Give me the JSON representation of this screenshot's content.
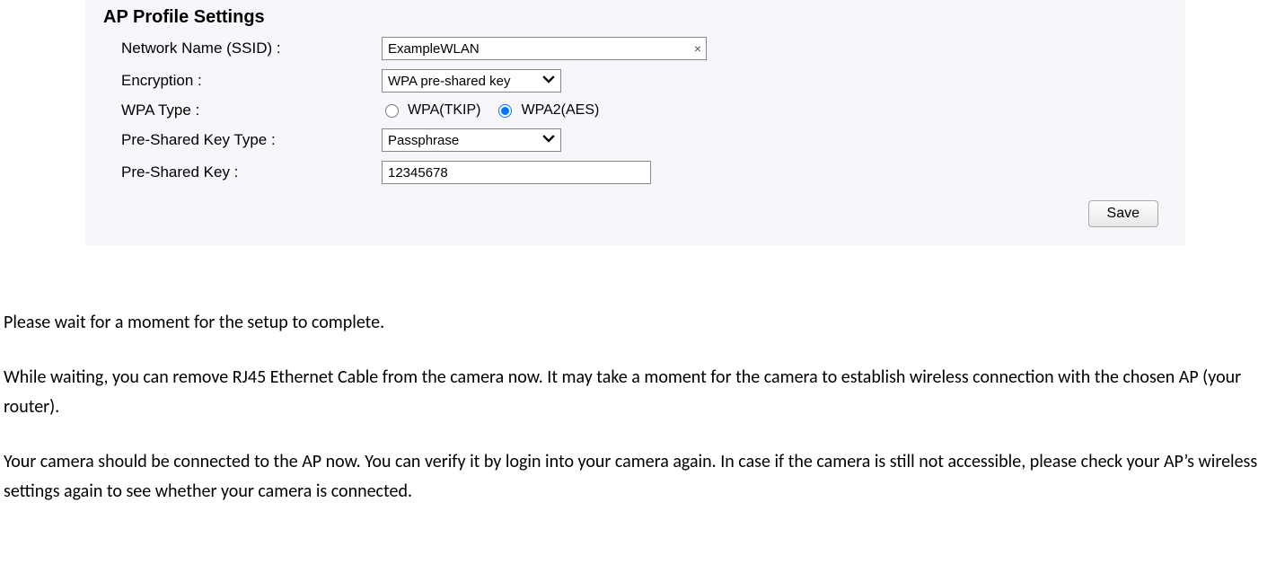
{
  "panel": {
    "title": "AP Profile Settings",
    "ssid_label": "Network Name (SSID) :",
    "ssid_value": "ExampleWLAN",
    "encryption_label": "Encryption :",
    "encryption_value": "WPA pre-shared key",
    "wpa_type_label": "WPA Type :",
    "wpa_tkip_label": "WPA(TKIP)",
    "wpa2_aes_label": "WPA2(AES)",
    "psk_type_label": "Pre-Shared Key Type :",
    "psk_type_value": "Passphrase",
    "psk_label": "Pre-Shared Key :",
    "psk_value": "12345678",
    "save_label": "Save"
  },
  "instructions": {
    "p1": "Please wait for a moment for the setup to complete.",
    "p2": "While waiting, you can remove RJ45 Ethernet Cable from the camera now. It may take a moment for the camera to establish wireless connection with the chosen AP (your router).",
    "p3": "Your camera should be connected to the AP now. You can verify it by login into your camera again. In case if the camera is still not accessible, please check your AP’s wireless settings again to see whether your camera is connected."
  }
}
